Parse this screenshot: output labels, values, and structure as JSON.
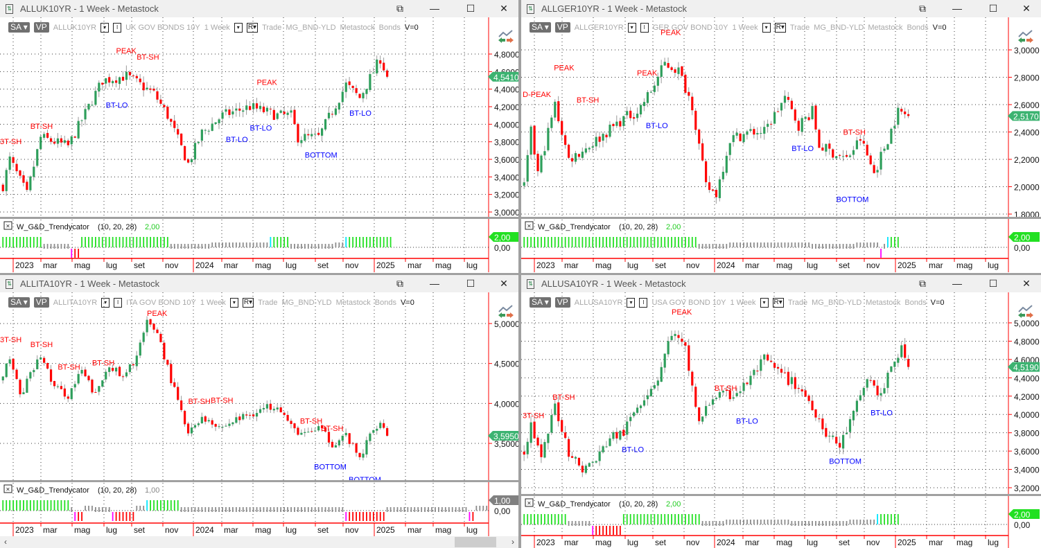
{
  "colors": {
    "up": "#2e9e5b",
    "down": "#ff0000",
    "axis": "#ff0000",
    "ind_up": "#22e022",
    "ind_gray": "#8c8c8c",
    "ind_cyan": "#00e5ff",
    "ind_magenta": "#ff00ff",
    "ind_down": "#ff0000",
    "label_red": "#ff0000",
    "label_blue": "#0000ff",
    "tag_green": "#3cb371",
    "tag_ind": "#22e022",
    "tag_gray": "#808080"
  },
  "window_controls": {
    "popout": "⧉",
    "minimize": "—",
    "maximize": "☐",
    "close": "✕"
  },
  "toolbar_common": {
    "sa": "SA",
    "vp": "VP",
    "period": "1 Week",
    "r": "R",
    "trade": "Trade",
    "list": "MG_BND-YLD",
    "source": "Metastock",
    "group": "Bonds",
    "v": "V=0",
    "drop": "▾",
    "i": "I"
  },
  "x_axis_labels": [
    "2023",
    "mar",
    "mag",
    "lug",
    "set",
    "nov",
    "2024",
    "mar",
    "mag",
    "lug",
    "set",
    "nov",
    "2025",
    "mar",
    "mag",
    "lug"
  ],
  "scroll": {
    "left": "‹",
    "right": "›"
  },
  "panels": [
    {
      "title": "ALLUK10YR - 1 Week - Metastock",
      "symbol": "ALLUK10YR",
      "description": "UK GOV BONDS 10Y",
      "price_ticks": [
        "4,8000",
        "4,6000",
        "4,4000",
        "4,2000",
        "4,0000",
        "3,8000",
        "3,6000",
        "3,4000",
        "3,2000",
        "3,0000"
      ],
      "tick_values": [
        4.8,
        4.6,
        4.4,
        4.2,
        4.0,
        3.8,
        3.6,
        3.4,
        3.2,
        3.0
      ],
      "last_price": "4,5410",
      "last_value": 4.541,
      "close_path": [
        [
          -3,
          3.3
        ],
        [
          -1,
          3.6
        ],
        [
          4,
          3.2
        ],
        [
          8,
          3.85
        ],
        [
          16,
          3.75
        ],
        [
          22,
          4.2
        ],
        [
          26,
          4.5
        ],
        [
          33,
          4.55
        ],
        [
          41,
          4.35
        ],
        [
          45,
          4.1
        ],
        [
          51,
          3.55
        ],
        [
          55,
          3.9
        ],
        [
          61,
          4.1
        ],
        [
          69,
          4.2
        ],
        [
          77,
          4.1
        ],
        [
          81,
          4.1
        ],
        [
          83,
          3.85
        ],
        [
          89,
          3.85
        ],
        [
          93,
          4.15
        ],
        [
          97,
          4.45
        ],
        [
          101,
          4.3
        ],
        [
          105,
          4.6
        ],
        [
          107,
          4.75
        ],
        [
          109,
          4.541
        ]
      ],
      "annotations": [
        {
          "text": "3T-SH",
          "week": -4,
          "price": 3.805,
          "kind": "red"
        },
        {
          "text": "BT-SH",
          "week": 5,
          "price": 3.98,
          "kind": "red"
        },
        {
          "text": "PEAK",
          "week": 30,
          "price": 4.84,
          "kind": "red"
        },
        {
          "text": "BT-SH",
          "week": 36,
          "price": 4.77,
          "kind": "red"
        },
        {
          "text": "BT-LO",
          "week": 27,
          "price": 4.22,
          "kind": "blue"
        },
        {
          "text": "PEAK",
          "week": 71,
          "price": 4.48,
          "kind": "red"
        },
        {
          "text": "BT-LO",
          "week": 62,
          "price": 3.83,
          "kind": "blue"
        },
        {
          "text": "BT-LO",
          "week": 69,
          "price": 3.96,
          "kind": "blue"
        },
        {
          "text": "BOTTOM",
          "week": 85,
          "price": 3.65,
          "kind": "blue"
        },
        {
          "text": "BT-LO",
          "week": 98,
          "price": 4.13,
          "kind": "blue"
        }
      ],
      "indicator": {
        "name": "W_G&D_Trendycator",
        "params": "(10,  20,  28)",
        "value": "2,00",
        "value_kind": "green",
        "zero_label": "0,00",
        "segments": [
          [
            "up",
            12
          ],
          [
            "flat",
            8
          ],
          [
            "mdown",
            1
          ],
          [
            "down",
            2
          ],
          [
            "up",
            26
          ],
          [
            "flat",
            12
          ],
          [
            "mid",
            17
          ],
          [
            "cyan",
            1
          ],
          [
            "up",
            5
          ],
          [
            "flat",
            13
          ],
          [
            "mid",
            3
          ],
          [
            "cyan",
            1
          ],
          [
            "up",
            13
          ]
        ]
      }
    },
    {
      "title": "ALLGER10YR - 1 Week - Metastock",
      "symbol": "ALLGER10YR",
      "description": "GER GOV BOND 10Y",
      "price_ticks": [
        "3,0000",
        "2,8000",
        "2,6000",
        "2,4000",
        "2,2000",
        "2,0000",
        "1,8000"
      ],
      "tick_values": [
        3.0,
        2.8,
        2.6,
        2.4,
        2.2,
        2.0,
        1.8
      ],
      "last_price": "2,5170",
      "last_value": 2.517,
      "close_path": [
        [
          -3,
          2.0
        ],
        [
          -1,
          2.4
        ],
        [
          1,
          2.1
        ],
        [
          6,
          2.6
        ],
        [
          10,
          2.2
        ],
        [
          16,
          2.3
        ],
        [
          26,
          2.5
        ],
        [
          30,
          2.55
        ],
        [
          34,
          2.7
        ],
        [
          38,
          2.9
        ],
        [
          42,
          2.85
        ],
        [
          46,
          2.6
        ],
        [
          50,
          2.0
        ],
        [
          53,
          1.95
        ],
        [
          57,
          2.35
        ],
        [
          63,
          2.4
        ],
        [
          67,
          2.4
        ],
        [
          73,
          2.65
        ],
        [
          77,
          2.45
        ],
        [
          81,
          2.55
        ],
        [
          83,
          2.3
        ],
        [
          87,
          2.25
        ],
        [
          91,
          2.2
        ],
        [
          95,
          2.35
        ],
        [
          99,
          2.1
        ],
        [
          103,
          2.35
        ],
        [
          106,
          2.55
        ],
        [
          109,
          2.517
        ]
      ],
      "annotations": [
        {
          "text": "D-PEAK",
          "week": -3.4,
          "price": 2.676,
          "kind": "red"
        },
        {
          "text": "PEAK",
          "week": 5.7,
          "price": 2.87,
          "kind": "red"
        },
        {
          "text": "BT-SH",
          "week": 12.3,
          "price": 2.635,
          "kind": "red"
        },
        {
          "text": "PEAK",
          "week": 29.9,
          "price": 2.833,
          "kind": "red"
        },
        {
          "text": "PEAK",
          "week": 36.8,
          "price": 3.13,
          "kind": "red"
        },
        {
          "text": "BT-LO",
          "week": 32.5,
          "price": 2.448,
          "kind": "blue"
        },
        {
          "text": "BT-LO",
          "week": 75,
          "price": 2.28,
          "kind": "blue"
        },
        {
          "text": "BT-SH",
          "week": 90,
          "price": 2.4,
          "kind": "red"
        },
        {
          "text": "BOTTOM",
          "week": 88,
          "price": 1.91,
          "kind": "blue"
        }
      ],
      "indicator": {
        "name": "W_G&D_Trendycator",
        "params": "(10,  20,  28)",
        "value": "2,00",
        "value_kind": "green",
        "zero_label": "0,00",
        "segments": [
          [
            "up",
            51
          ],
          [
            "flat",
            9
          ],
          [
            "mid",
            24
          ],
          [
            "flat",
            13
          ],
          [
            "mid",
            7
          ],
          [
            "mdown",
            1
          ],
          [
            "flat",
            1
          ],
          [
            "cyan",
            1
          ],
          [
            "up",
            3
          ]
        ]
      }
    },
    {
      "title": "ALLITA10YR - 1 Week - Metastock",
      "symbol": "ALLITA10YR",
      "description": "ITA GOV BOND 10Y",
      "price_ticks": [
        "5,0000",
        "4,5000",
        "4,0000",
        "3,5000"
      ],
      "tick_values": [
        5.0,
        4.5,
        4.0,
        3.5
      ],
      "last_price": "3,5950",
      "last_value": 3.595,
      "close_path": [
        [
          -3,
          4.3
        ],
        [
          -1,
          4.6
        ],
        [
          2,
          4.1
        ],
        [
          8,
          4.6
        ],
        [
          12,
          4.2
        ],
        [
          16,
          4.1
        ],
        [
          20,
          4.4
        ],
        [
          24,
          4.1
        ],
        [
          28,
          4.5
        ],
        [
          32,
          4.3
        ],
        [
          36,
          4.6
        ],
        [
          39,
          5.0
        ],
        [
          42,
          4.9
        ],
        [
          46,
          4.3
        ],
        [
          51,
          3.6
        ],
        [
          54,
          3.8
        ],
        [
          57,
          3.8
        ],
        [
          61,
          3.7
        ],
        [
          65,
          3.8
        ],
        [
          71,
          3.9
        ],
        [
          77,
          4.0
        ],
        [
          81,
          3.7
        ],
        [
          85,
          3.6
        ],
        [
          89,
          3.7
        ],
        [
          93,
          3.5
        ],
        [
          97,
          3.6
        ],
        [
          101,
          3.3
        ],
        [
          104,
          3.6
        ],
        [
          107,
          3.8
        ],
        [
          109,
          3.595
        ]
      ],
      "annotations": [
        {
          "text": "3T-SH",
          "week": -4,
          "price": 4.8,
          "kind": "red"
        },
        {
          "text": "BT-SH",
          "week": 5,
          "price": 4.74,
          "kind": "red"
        },
        {
          "text": "BT-SH",
          "week": 13,
          "price": 4.46,
          "kind": "red"
        },
        {
          "text": "BT-SH",
          "week": 23,
          "price": 4.51,
          "kind": "red"
        },
        {
          "text": "PEAK",
          "week": 39,
          "price": 5.13,
          "kind": "red"
        },
        {
          "text": "BT-SH",
          "week": 51,
          "price": 4.03,
          "kind": "red"
        },
        {
          "text": "BT-SH",
          "week": 57.6,
          "price": 4.04,
          "kind": "red"
        },
        {
          "text": "BT-SH",
          "week": 83.6,
          "price": 3.78,
          "kind": "red"
        },
        {
          "text": "BT-SH",
          "week": 89.7,
          "price": 3.69,
          "kind": "red"
        },
        {
          "text": "BOTTOM",
          "week": 87.7,
          "price": 3.21,
          "kind": "blue"
        },
        {
          "text": "BOTTOM",
          "week": 97.8,
          "price": 3.05,
          "kind": "blue"
        }
      ],
      "indicator": {
        "name": "W_G&D_Trendycator",
        "params": "(10,  20,  28)",
        "value": "1,00",
        "value_kind": "gray",
        "zero_label": "0,00",
        "segments": [
          [
            "up",
            20
          ],
          [
            "flat",
            1
          ],
          [
            "mdown",
            1
          ],
          [
            "down",
            2
          ],
          [
            "mid",
            3
          ],
          [
            "flat",
            5
          ],
          [
            "mdown",
            1
          ],
          [
            "down",
            6
          ],
          [
            "mid",
            3
          ],
          [
            "cyan",
            1
          ],
          [
            "up",
            9
          ],
          [
            "flat",
            48
          ],
          [
            "mdown",
            1
          ],
          [
            "down",
            11
          ],
          [
            "flat",
            24
          ],
          [
            "mdown",
            1
          ],
          [
            "down",
            1
          ],
          [
            "mid",
            4
          ]
        ]
      }
    },
    {
      "title": "ALLUSA10YR - 1 Week - Metastock",
      "symbol": "ALLUSA10YR",
      "description": "USA GOV BOND 10Y",
      "price_ticks": [
        "5,0000",
        "4,8000",
        "4,6000",
        "4,4000",
        "4,2000",
        "4,0000",
        "3,8000",
        "3,6000",
        "3,4000",
        "3,2000"
      ],
      "tick_values": [
        5.0,
        4.8,
        4.6,
        4.4,
        4.2,
        4.0,
        3.8,
        3.6,
        3.4,
        3.2
      ],
      "last_price": "4,5190",
      "last_value": 4.519,
      "close_path": [
        [
          -3,
          3.6
        ],
        [
          -1,
          3.9
        ],
        [
          2,
          3.5
        ],
        [
          6,
          4.1
        ],
        [
          10,
          3.6
        ],
        [
          14,
          3.4
        ],
        [
          18,
          3.5
        ],
        [
          22,
          3.75
        ],
        [
          26,
          3.8
        ],
        [
          30,
          4.1
        ],
        [
          36,
          4.4
        ],
        [
          40,
          4.9
        ],
        [
          44,
          4.7
        ],
        [
          48,
          3.9
        ],
        [
          52,
          4.2
        ],
        [
          57,
          4.2
        ],
        [
          61,
          4.3
        ],
        [
          67,
          4.6
        ],
        [
          73,
          4.4
        ],
        [
          77,
          4.3
        ],
        [
          81,
          4.1
        ],
        [
          85,
          3.8
        ],
        [
          89,
          3.65
        ],
        [
          93,
          4.0
        ],
        [
          97,
          4.4
        ],
        [
          101,
          4.2
        ],
        [
          105,
          4.6
        ],
        [
          107,
          4.7
        ],
        [
          109,
          4.519
        ]
      ],
      "annotations": [
        {
          "text": "3T-SH",
          "week": -3.4,
          "price": 3.99,
          "kind": "red"
        },
        {
          "text": "BT-SH",
          "week": 5.3,
          "price": 4.19,
          "kind": "red"
        },
        {
          "text": "PEAK",
          "week": 40,
          "price": 5.12,
          "kind": "red"
        },
        {
          "text": "BT-SH",
          "week": 52.5,
          "price": 4.29,
          "kind": "red"
        },
        {
          "text": "BT-LO",
          "week": 25.5,
          "price": 3.62,
          "kind": "blue"
        },
        {
          "text": "BT-LO",
          "week": 58.8,
          "price": 3.93,
          "kind": "blue"
        },
        {
          "text": "BOTTOM",
          "week": 85.9,
          "price": 3.49,
          "kind": "blue"
        },
        {
          "text": "BT-LO",
          "week": 98,
          "price": 4.02,
          "kind": "blue"
        }
      ],
      "indicator": {
        "name": "W_G&D_Trendycator",
        "params": "(10,  20,  28)",
        "value": "2,00",
        "value_kind": "green",
        "zero_label": "0,00",
        "segments": [
          [
            "up",
            13
          ],
          [
            "flat",
            7
          ],
          [
            "mdown",
            1
          ],
          [
            "down",
            8
          ],
          [
            "up",
            23
          ],
          [
            "flat",
            7
          ],
          [
            "mid",
            19
          ],
          [
            "flat",
            17
          ],
          [
            "mid",
            8
          ],
          [
            "cyan",
            1
          ],
          [
            "up",
            6
          ]
        ]
      }
    }
  ]
}
